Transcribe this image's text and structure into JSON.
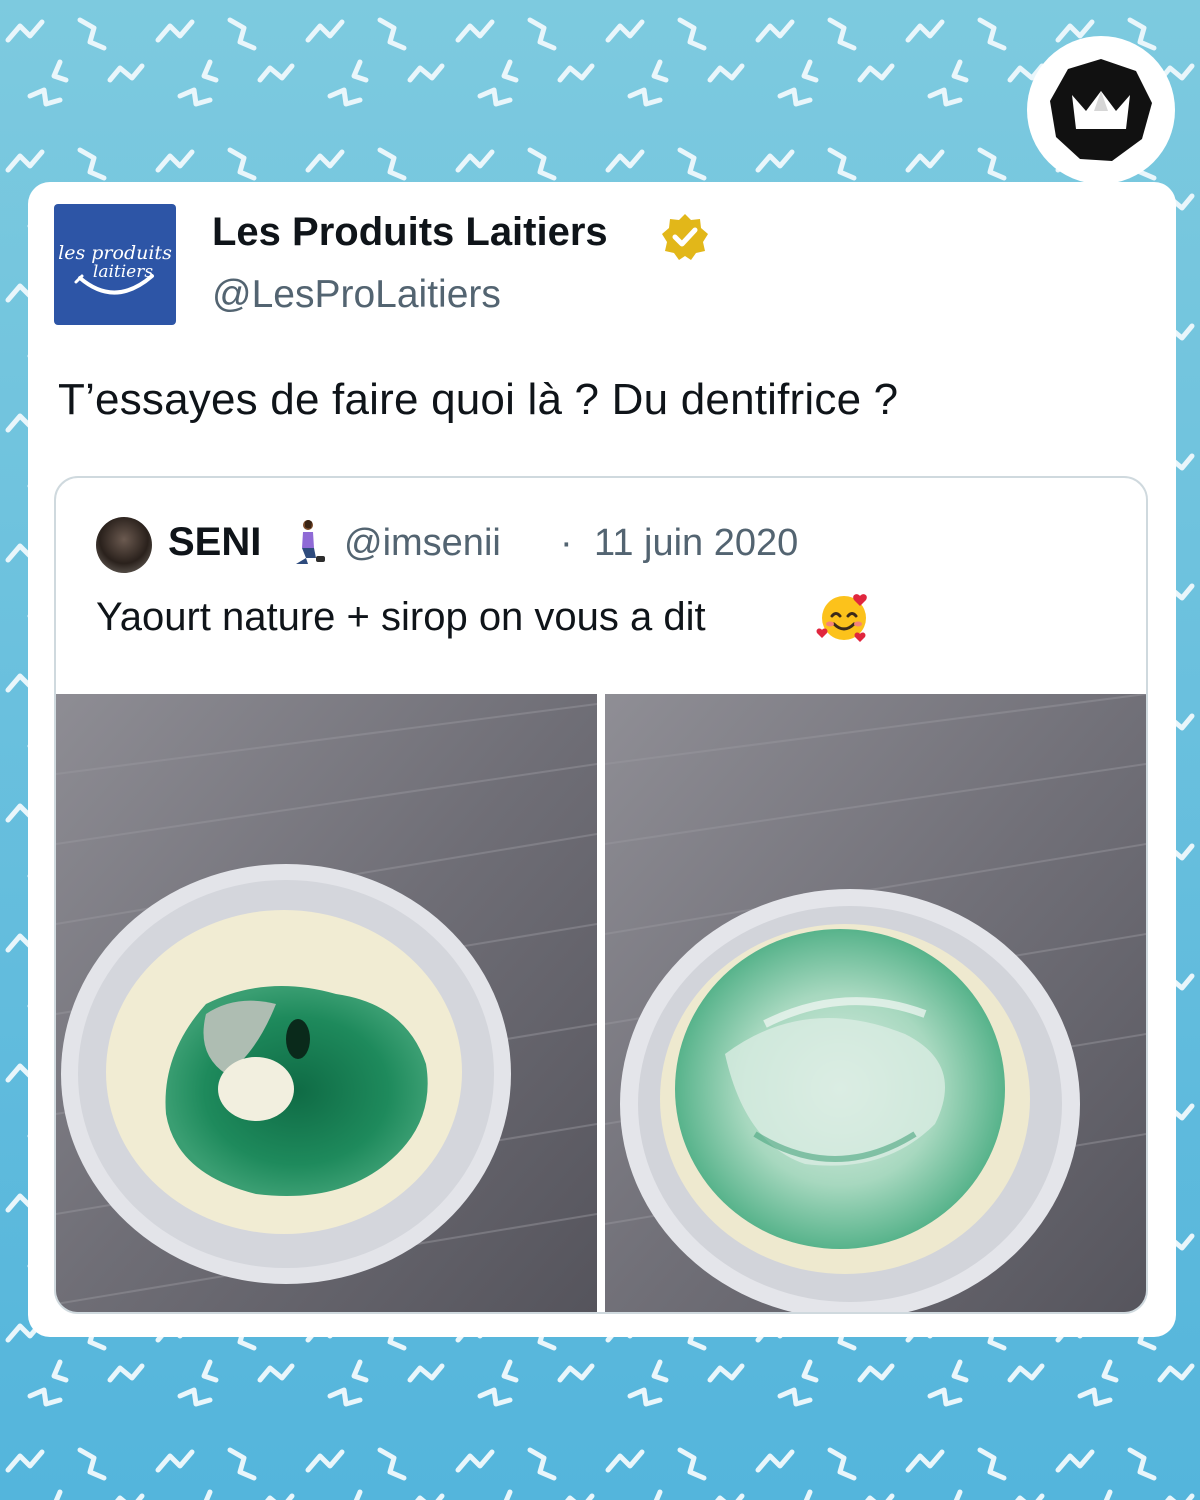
{
  "colors": {
    "background": "#6cc3dc",
    "card": "#ffffff",
    "text_primary": "#0f1419",
    "text_secondary": "#536471",
    "avatar_blue": "#2d55a6",
    "verified_gold": "#e2b719",
    "syrup_green": "#1e8a5c"
  },
  "brand": {
    "icon": "crown-icon"
  },
  "tweet": {
    "avatar_logo": {
      "line1": "les produits",
      "line2": "laitiers"
    },
    "author_name": "Les Produits Laitiers",
    "verified_icon": "verified-badge-icon",
    "handle": "@LesProLaitiers",
    "text": "T’essayes de faire quoi là ? Du dentifrice ?"
  },
  "quoted_tweet": {
    "author_name": "SENI",
    "name_emoji": "kneeling-woman-icon",
    "handle": "@imsenii",
    "separator": "·",
    "date": "11 juin 2020",
    "text": "Yaourt nature + sirop on vous a dit",
    "text_emoji": "smiling-face-with-hearts-icon",
    "photos": [
      {
        "name": "yogurt-with-syrup-unmixed"
      },
      {
        "name": "yogurt-with-syrup-mixed"
      }
    ]
  }
}
